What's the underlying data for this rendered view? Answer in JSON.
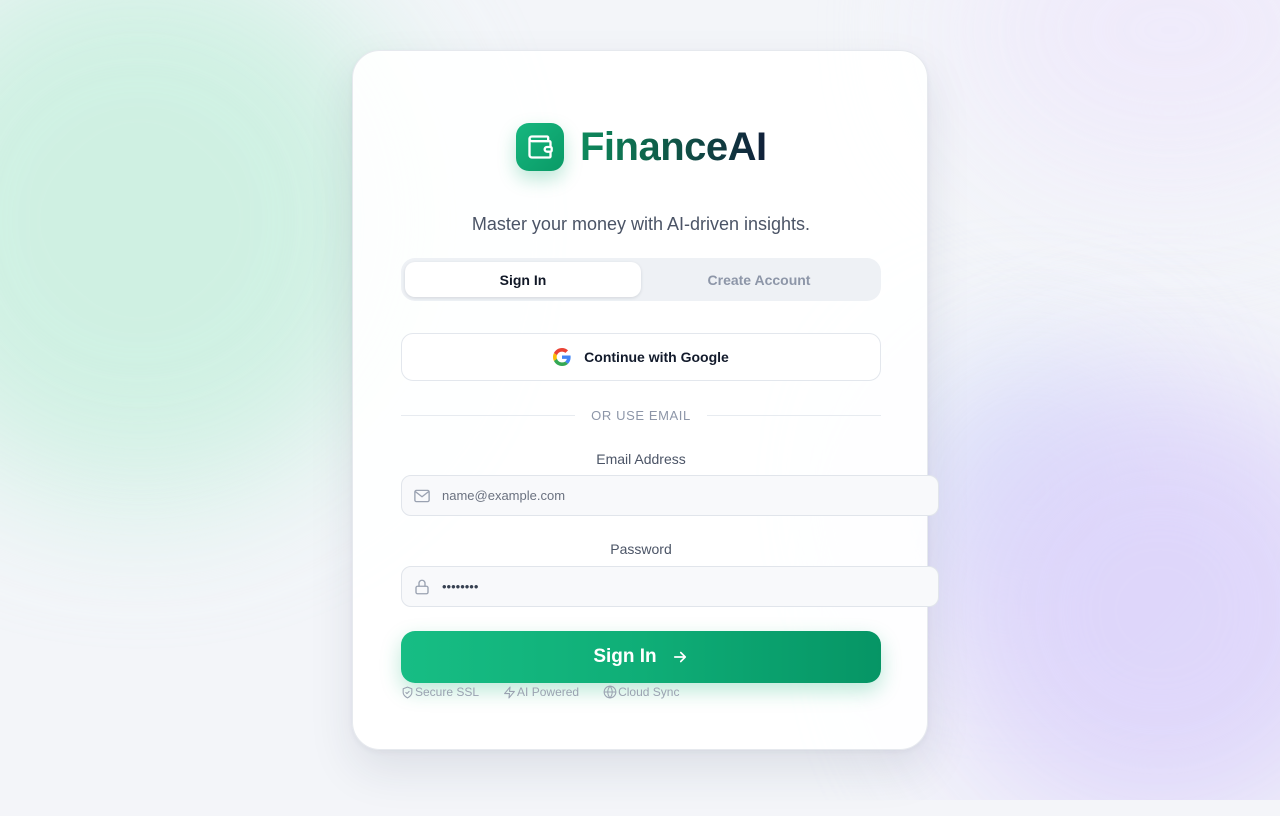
{
  "brand": {
    "name": "FinanceAI",
    "icon": "wallet-icon",
    "accent": "#10b47c"
  },
  "tagline": "Master your money with AI-driven insights.",
  "tabs": [
    {
      "label": "Sign In",
      "active": true
    },
    {
      "label": "Create Account",
      "active": false
    }
  ],
  "google_button": {
    "label": "Continue with Google",
    "icon": "google-icon"
  },
  "divider": {
    "text": "OR USE EMAIL"
  },
  "email": {
    "label": "Email Address",
    "placeholder": "name@example.com",
    "icon": "mail-icon"
  },
  "password": {
    "label": "Password",
    "value": "••••••••",
    "icon": "lock-icon"
  },
  "submit": {
    "label": "Sign In",
    "icon": "arrow-right-icon"
  },
  "badges": [
    {
      "label": "Secure SSL",
      "icon": "shield-icon"
    },
    {
      "label": "AI Powered",
      "icon": "bolt-icon"
    },
    {
      "label": "Cloud Sync",
      "icon": "globe-icon"
    }
  ]
}
